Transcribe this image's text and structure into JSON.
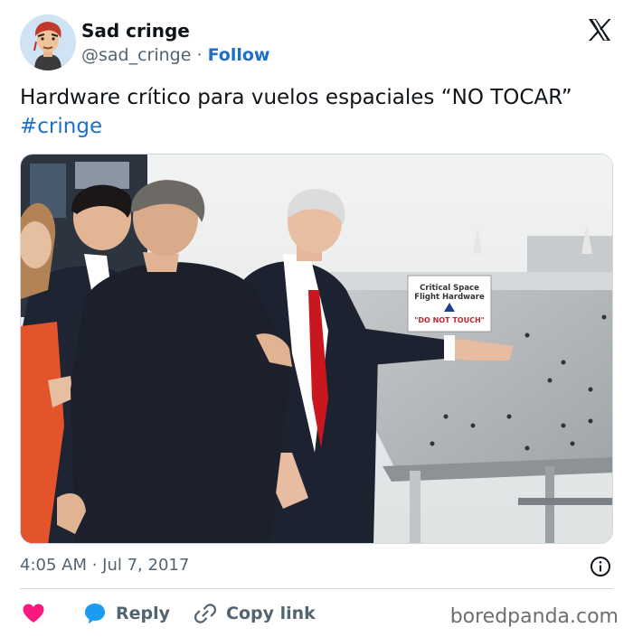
{
  "author": {
    "display_name": "Sad cringe",
    "handle": "@sad_cringe",
    "separator": "·",
    "follow_label": "Follow",
    "avatar_icon": "avatar-illustration-icon"
  },
  "post": {
    "text": "Hardware crítico para vuelos espaciales “NO TOCAR”",
    "hashtag": "#cringe",
    "timestamp": "4:05 AM · Jul 7, 2017"
  },
  "media": {
    "sign_line1": "Critical Space",
    "sign_line2": "Flight Hardware",
    "sign_warning": "\"DO NOT TOUCH\""
  },
  "actions": {
    "like_icon": "heart-icon",
    "reply_label": "Reply",
    "copy_label": "Copy link"
  },
  "brand": {
    "watermark": "boredpanda.com"
  },
  "colors": {
    "accent": "#1d6fc9",
    "heart": "#f91880",
    "muted": "#536471",
    "text": "#0f1419"
  }
}
